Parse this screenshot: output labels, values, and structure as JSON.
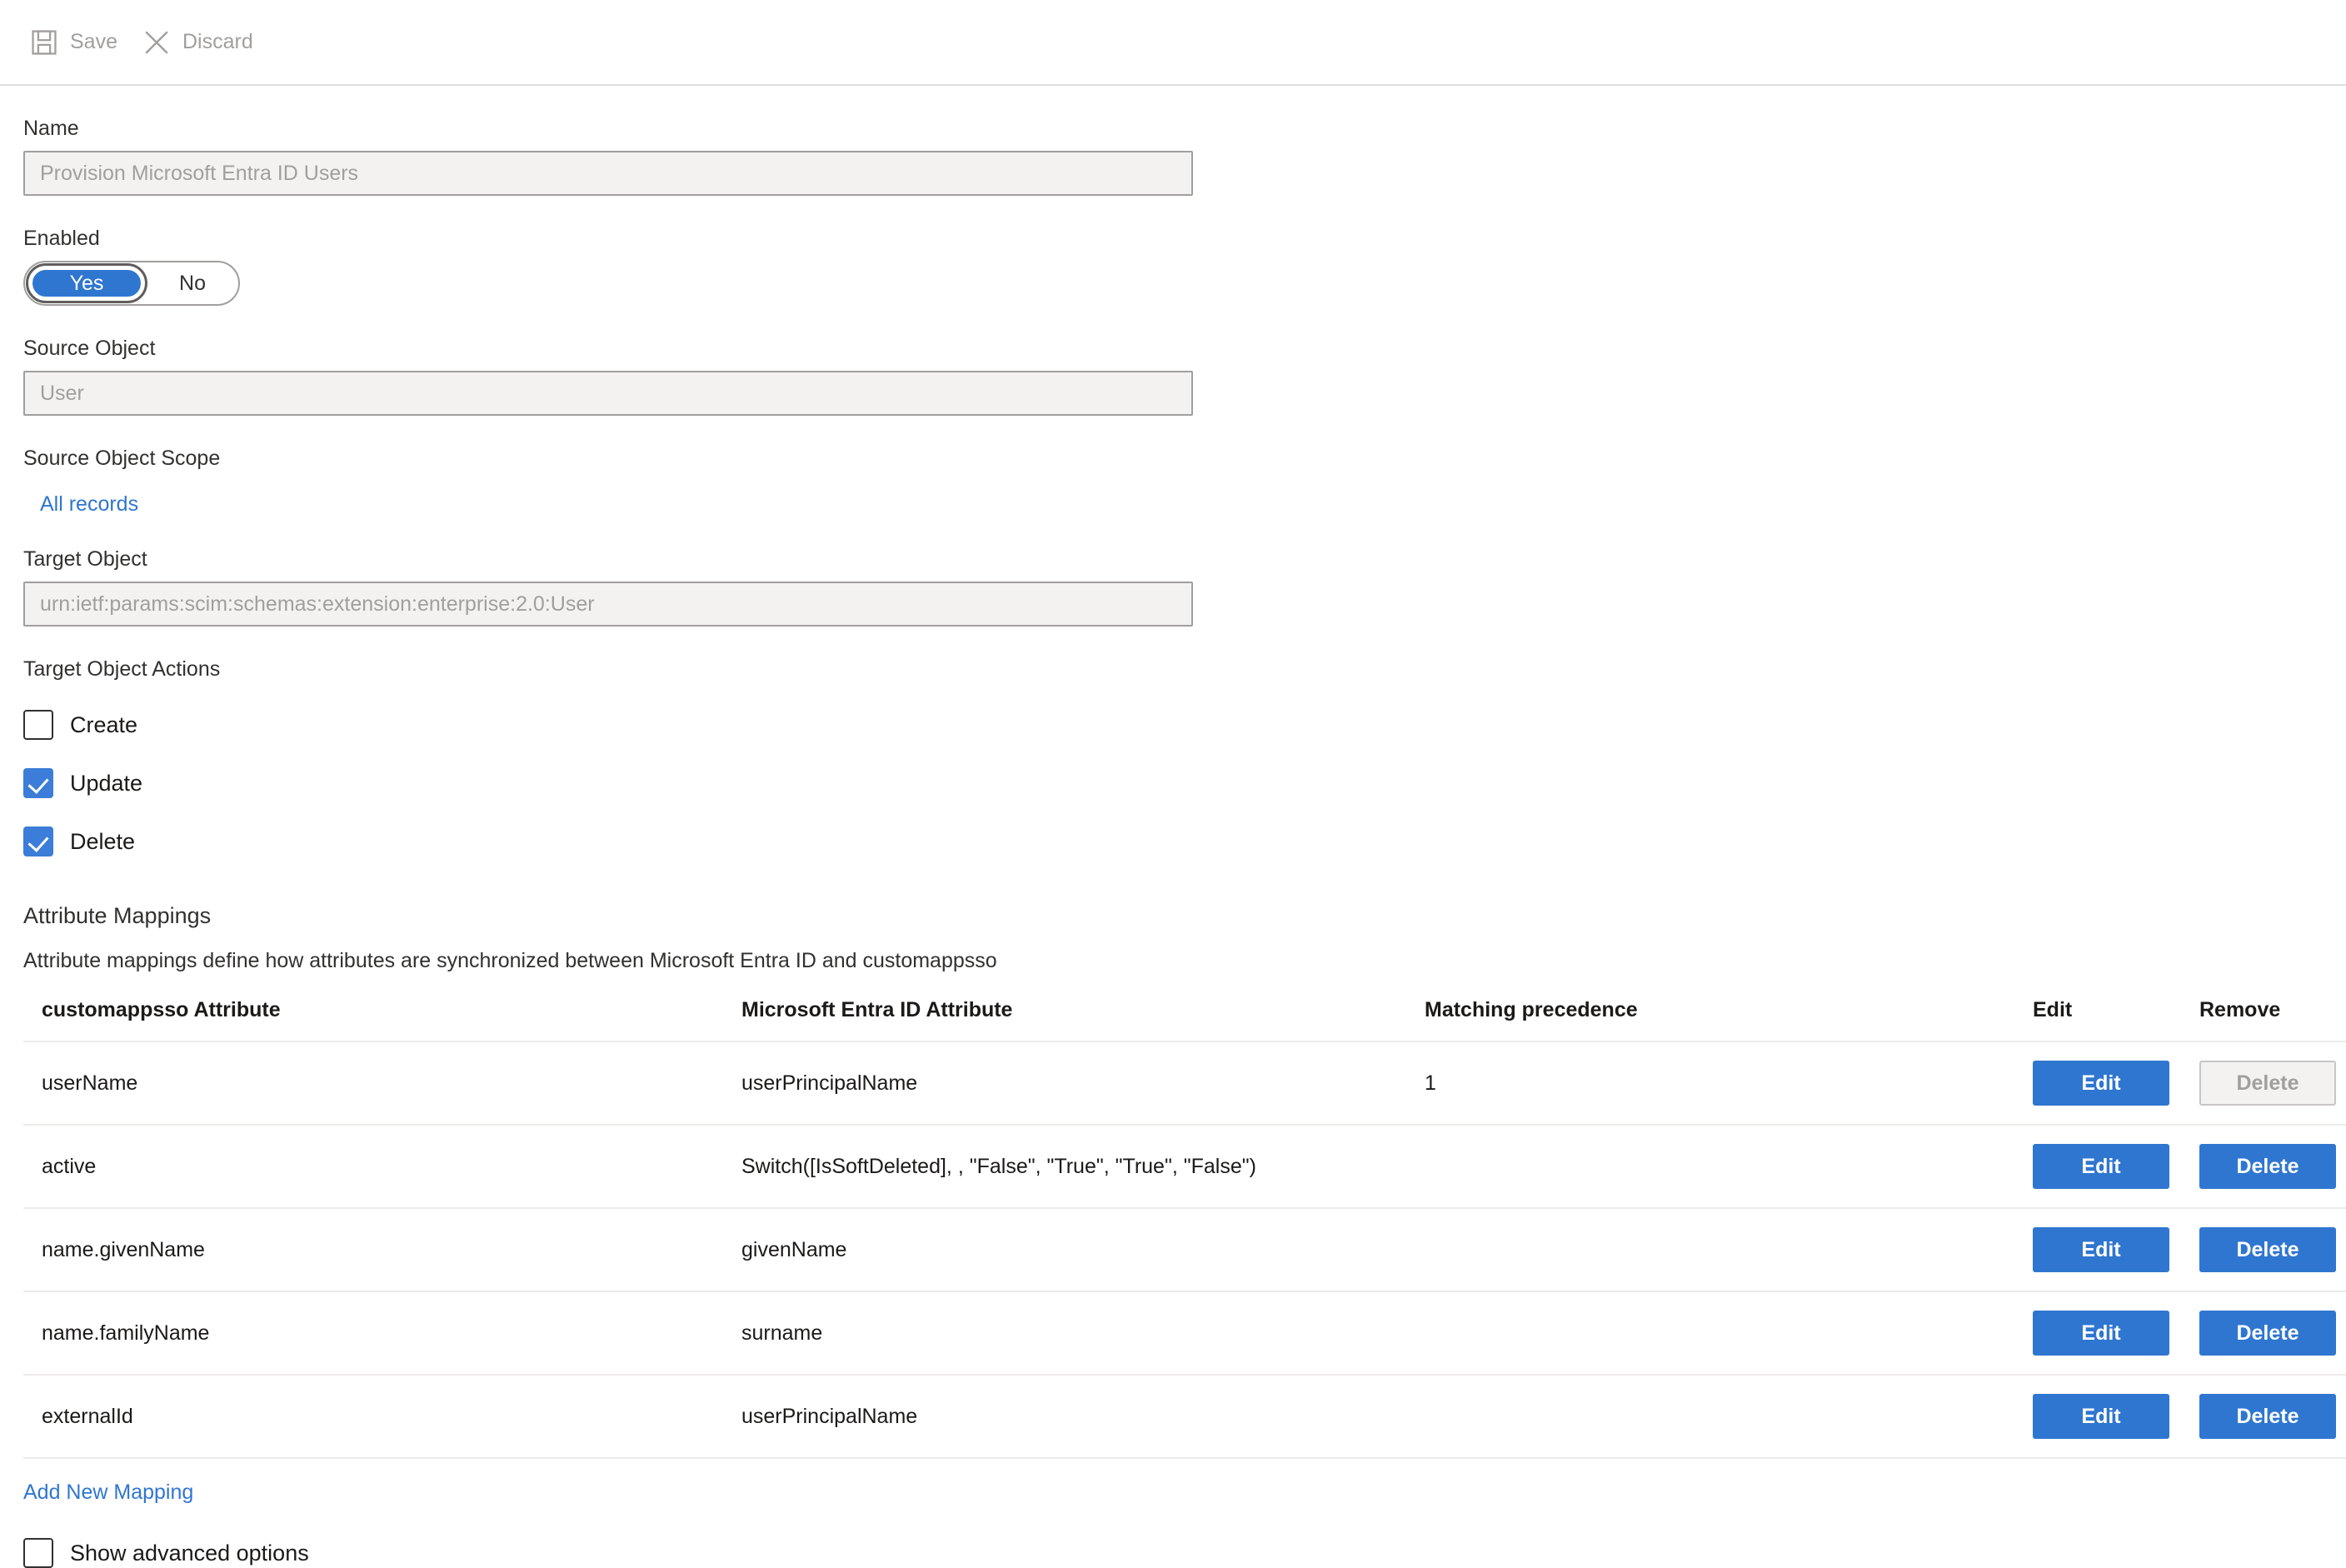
{
  "toolbar": {
    "save_label": "Save",
    "discard_label": "Discard"
  },
  "form": {
    "name_label": "Name",
    "name_value": "Provision Microsoft Entra ID Users",
    "enabled_label": "Enabled",
    "enabled_yes": "Yes",
    "enabled_no": "No",
    "enabled_value": "Yes",
    "source_object_label": "Source Object",
    "source_object_value": "User",
    "source_object_scope_label": "Source Object Scope",
    "source_object_scope_link": "All records",
    "target_object_label": "Target Object",
    "target_object_value": "urn:ietf:params:scim:schemas:extension:enterprise:2.0:User",
    "target_object_actions_label": "Target Object Actions",
    "actions": [
      {
        "label": "Create",
        "checked": false
      },
      {
        "label": "Update",
        "checked": true
      },
      {
        "label": "Delete",
        "checked": true
      }
    ]
  },
  "mappings": {
    "title": "Attribute Mappings",
    "description": "Attribute mappings define how attributes are synchronized between Microsoft Entra ID and customappsso",
    "columns": {
      "source": "customappsso Attribute",
      "target": "Microsoft Entra ID Attribute",
      "precedence": "Matching precedence",
      "edit": "Edit",
      "remove": "Remove"
    },
    "edit_label": "Edit",
    "delete_label": "Delete",
    "rows": [
      {
        "source": "userName",
        "target": "userPrincipalName",
        "precedence": "1",
        "delete_enabled": false
      },
      {
        "source": "active",
        "target": "Switch([IsSoftDeleted], , \"False\", \"True\", \"True\", \"False\")",
        "precedence": "",
        "delete_enabled": true
      },
      {
        "source": "name.givenName",
        "target": "givenName",
        "precedence": "",
        "delete_enabled": true
      },
      {
        "source": "name.familyName",
        "target": "surname",
        "precedence": "",
        "delete_enabled": true
      },
      {
        "source": "externalId",
        "target": "userPrincipalName",
        "precedence": "",
        "delete_enabled": true
      }
    ],
    "add_new_mapping": "Add New Mapping",
    "show_advanced_options": "Show advanced options",
    "show_advanced_checked": false
  },
  "colors": {
    "accent_blue": "#2f76d0",
    "checkbox_blue": "#3b7dd8",
    "link_blue": "#2f76d0",
    "disabled_text": "#a19f9d",
    "disabled_bg": "#f3f2f1",
    "border_grey": "#a19f9d",
    "row_divider": "#edebe9"
  }
}
